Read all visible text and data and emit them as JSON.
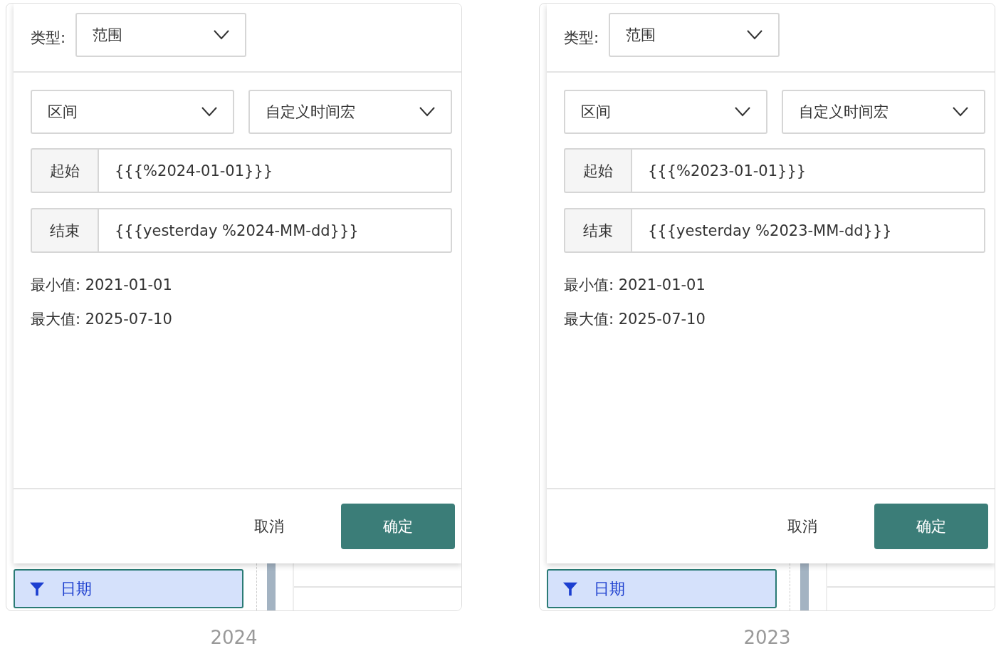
{
  "panels": [
    {
      "type_label": "类型:",
      "type_value": "范围",
      "mode": "区间",
      "macro": "自定义时间宏",
      "start_label": "起始",
      "start_value": "{{{%2024-01-01}}}",
      "end_label": "结束",
      "end_value": "{{{yesterday %2024-MM-dd}}}",
      "min": "最小值: 2021-01-01",
      "max": "最大值: 2025-07-10",
      "cancel": "取消",
      "confirm": "确定",
      "field": "日期",
      "caption": "2024"
    },
    {
      "type_label": "类型:",
      "type_value": "范围",
      "mode": "区间",
      "macro": "自定义时间宏",
      "start_label": "起始",
      "start_value": "{{{%2023-01-01}}}",
      "end_label": "结束",
      "end_value": "{{{yesterday %2023-MM-dd}}}",
      "min": "最小值: 2021-01-01",
      "max": "最大值: 2025-07-10",
      "cancel": "取消",
      "confirm": "确定",
      "field": "日期",
      "caption": "2023"
    }
  ]
}
